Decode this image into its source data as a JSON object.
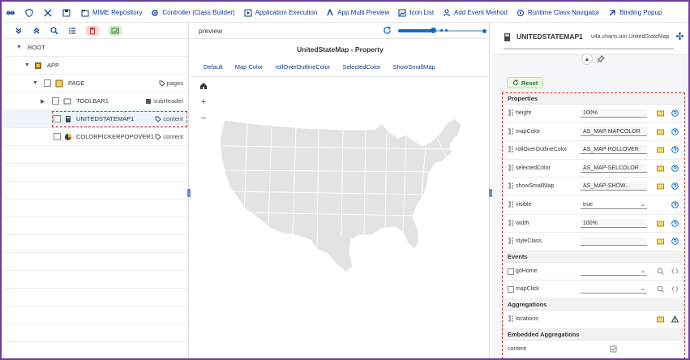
{
  "toolbar": {
    "buttons": [
      {
        "label": "MIME Repository"
      },
      {
        "label": "Controller (Class Builder)"
      },
      {
        "label": "Application Execution"
      },
      {
        "label": "App Multi Preview"
      },
      {
        "label": "Icon List"
      },
      {
        "label": "Add Event Method"
      },
      {
        "label": "Runtime Class Navigator"
      },
      {
        "label": "Binding Popup"
      }
    ]
  },
  "tree": {
    "nodes": [
      {
        "label": "ROOT",
        "type": ""
      },
      {
        "label": "APP",
        "type": ""
      },
      {
        "label": "PAGE",
        "type": "pages"
      },
      {
        "label": "TOOLBAR1",
        "type": "subHeader"
      },
      {
        "label": "UNITEDSTATEMAP1",
        "type": "content"
      },
      {
        "label": "COLORPICKERPOPOVER1",
        "type": "content"
      }
    ]
  },
  "preview": {
    "title": "preview",
    "property_title": "UnitedStateMap - Property",
    "tabs": [
      "Default",
      "Map Color",
      "rollOverOutlineColor",
      "SelectedColor",
      "ShowSmallMap"
    ],
    "slider_level": 0.4
  },
  "inspector": {
    "name": "UNITEDSTATEMAP1",
    "class_name": "u4a.charts.am.UnitedStateMap",
    "reset_label": "Reset",
    "sections": {
      "properties": "Properties",
      "events": "Events",
      "aggregations": "Aggregations",
      "embedded": "Embedded Aggregations"
    },
    "properties": [
      {
        "name": "height",
        "value": "100%",
        "kind": "input"
      },
      {
        "name": "mapColor",
        "value": "AS_MAP-MAPCOLOR",
        "kind": "input"
      },
      {
        "name": "rollOverOutlineColor",
        "value": "AS_MAP-ROLLOVER",
        "kind": "input"
      },
      {
        "name": "selectedColor",
        "value": "AS_MAP-SELCOLOR",
        "kind": "input"
      },
      {
        "name": "showSmallMap",
        "value": "AS_MAP-SHOW...",
        "kind": "input"
      },
      {
        "name": "visible",
        "value": "true",
        "kind": "select"
      },
      {
        "name": "width",
        "value": "100%",
        "kind": "input"
      },
      {
        "name": "styleClass",
        "value": "",
        "kind": "input"
      }
    ],
    "events": [
      {
        "name": "goHome",
        "value": ""
      },
      {
        "name": "mapClick",
        "value": ""
      }
    ],
    "aggregations": [
      {
        "name": "locations"
      }
    ],
    "embedded": [
      {
        "name": "content"
      }
    ]
  },
  "colors": {
    "accent": "#0a6ed1",
    "link": "#0a3d8c",
    "highlight": "#c0392b",
    "frame": "#6a3d9a",
    "map_fill": "#e3e3e3"
  }
}
